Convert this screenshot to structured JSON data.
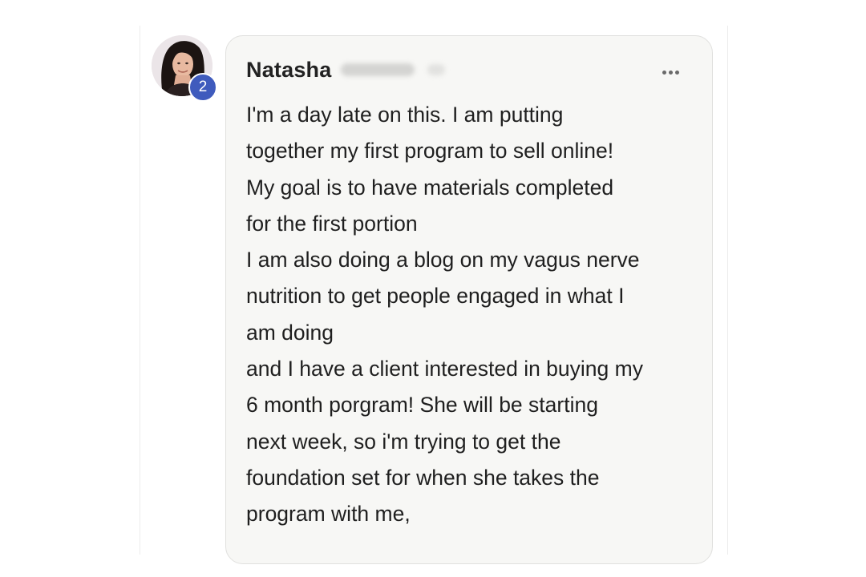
{
  "comment": {
    "author": {
      "name": "Natasha",
      "badge_count": "2"
    },
    "body_lines": [
      "I'm a day late on this. I am putting",
      "together my first program to sell online!",
      "My goal is to have materials completed",
      "for the first portion",
      "I am also doing a blog on my vagus nerve",
      "nutrition to get people engaged in what I",
      "am doing",
      "and I have a client interested in buying my",
      "6 month porgram! She will be starting",
      "next week, so i'm trying to get the",
      "foundation set for when she takes the",
      "program with me,"
    ],
    "more_icon": "more-horizontal-icon"
  },
  "colors": {
    "badge": "#3f5bbd",
    "bubble_background": "#f7f7f5",
    "text": "#1f1f1f"
  }
}
